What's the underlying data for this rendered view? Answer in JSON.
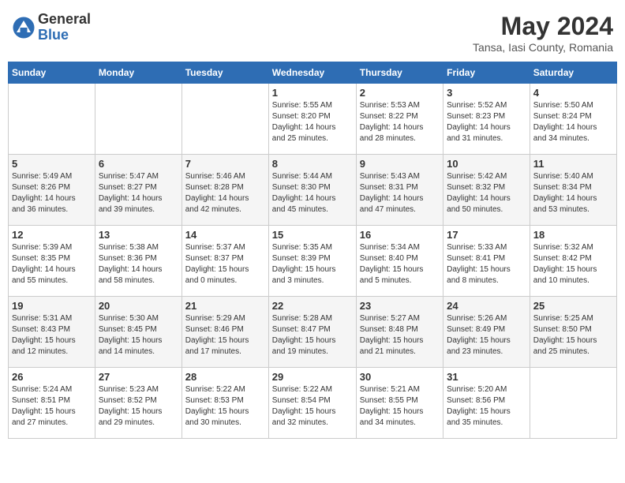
{
  "header": {
    "logo_general": "General",
    "logo_blue": "Blue",
    "month_year": "May 2024",
    "location": "Tansa, Iasi County, Romania"
  },
  "days_of_week": [
    "Sunday",
    "Monday",
    "Tuesday",
    "Wednesday",
    "Thursday",
    "Friday",
    "Saturday"
  ],
  "weeks": [
    [
      {
        "day": "",
        "info": ""
      },
      {
        "day": "",
        "info": ""
      },
      {
        "day": "",
        "info": ""
      },
      {
        "day": "1",
        "info": "Sunrise: 5:55 AM\nSunset: 8:20 PM\nDaylight: 14 hours\nand 25 minutes."
      },
      {
        "day": "2",
        "info": "Sunrise: 5:53 AM\nSunset: 8:22 PM\nDaylight: 14 hours\nand 28 minutes."
      },
      {
        "day": "3",
        "info": "Sunrise: 5:52 AM\nSunset: 8:23 PM\nDaylight: 14 hours\nand 31 minutes."
      },
      {
        "day": "4",
        "info": "Sunrise: 5:50 AM\nSunset: 8:24 PM\nDaylight: 14 hours\nand 34 minutes."
      }
    ],
    [
      {
        "day": "5",
        "info": "Sunrise: 5:49 AM\nSunset: 8:26 PM\nDaylight: 14 hours\nand 36 minutes."
      },
      {
        "day": "6",
        "info": "Sunrise: 5:47 AM\nSunset: 8:27 PM\nDaylight: 14 hours\nand 39 minutes."
      },
      {
        "day": "7",
        "info": "Sunrise: 5:46 AM\nSunset: 8:28 PM\nDaylight: 14 hours\nand 42 minutes."
      },
      {
        "day": "8",
        "info": "Sunrise: 5:44 AM\nSunset: 8:30 PM\nDaylight: 14 hours\nand 45 minutes."
      },
      {
        "day": "9",
        "info": "Sunrise: 5:43 AM\nSunset: 8:31 PM\nDaylight: 14 hours\nand 47 minutes."
      },
      {
        "day": "10",
        "info": "Sunrise: 5:42 AM\nSunset: 8:32 PM\nDaylight: 14 hours\nand 50 minutes."
      },
      {
        "day": "11",
        "info": "Sunrise: 5:40 AM\nSunset: 8:34 PM\nDaylight: 14 hours\nand 53 minutes."
      }
    ],
    [
      {
        "day": "12",
        "info": "Sunrise: 5:39 AM\nSunset: 8:35 PM\nDaylight: 14 hours\nand 55 minutes."
      },
      {
        "day": "13",
        "info": "Sunrise: 5:38 AM\nSunset: 8:36 PM\nDaylight: 14 hours\nand 58 minutes."
      },
      {
        "day": "14",
        "info": "Sunrise: 5:37 AM\nSunset: 8:37 PM\nDaylight: 15 hours\nand 0 minutes."
      },
      {
        "day": "15",
        "info": "Sunrise: 5:35 AM\nSunset: 8:39 PM\nDaylight: 15 hours\nand 3 minutes."
      },
      {
        "day": "16",
        "info": "Sunrise: 5:34 AM\nSunset: 8:40 PM\nDaylight: 15 hours\nand 5 minutes."
      },
      {
        "day": "17",
        "info": "Sunrise: 5:33 AM\nSunset: 8:41 PM\nDaylight: 15 hours\nand 8 minutes."
      },
      {
        "day": "18",
        "info": "Sunrise: 5:32 AM\nSunset: 8:42 PM\nDaylight: 15 hours\nand 10 minutes."
      }
    ],
    [
      {
        "day": "19",
        "info": "Sunrise: 5:31 AM\nSunset: 8:43 PM\nDaylight: 15 hours\nand 12 minutes."
      },
      {
        "day": "20",
        "info": "Sunrise: 5:30 AM\nSunset: 8:45 PM\nDaylight: 15 hours\nand 14 minutes."
      },
      {
        "day": "21",
        "info": "Sunrise: 5:29 AM\nSunset: 8:46 PM\nDaylight: 15 hours\nand 17 minutes."
      },
      {
        "day": "22",
        "info": "Sunrise: 5:28 AM\nSunset: 8:47 PM\nDaylight: 15 hours\nand 19 minutes."
      },
      {
        "day": "23",
        "info": "Sunrise: 5:27 AM\nSunset: 8:48 PM\nDaylight: 15 hours\nand 21 minutes."
      },
      {
        "day": "24",
        "info": "Sunrise: 5:26 AM\nSunset: 8:49 PM\nDaylight: 15 hours\nand 23 minutes."
      },
      {
        "day": "25",
        "info": "Sunrise: 5:25 AM\nSunset: 8:50 PM\nDaylight: 15 hours\nand 25 minutes."
      }
    ],
    [
      {
        "day": "26",
        "info": "Sunrise: 5:24 AM\nSunset: 8:51 PM\nDaylight: 15 hours\nand 27 minutes."
      },
      {
        "day": "27",
        "info": "Sunrise: 5:23 AM\nSunset: 8:52 PM\nDaylight: 15 hours\nand 29 minutes."
      },
      {
        "day": "28",
        "info": "Sunrise: 5:22 AM\nSunset: 8:53 PM\nDaylight: 15 hours\nand 30 minutes."
      },
      {
        "day": "29",
        "info": "Sunrise: 5:22 AM\nSunset: 8:54 PM\nDaylight: 15 hours\nand 32 minutes."
      },
      {
        "day": "30",
        "info": "Sunrise: 5:21 AM\nSunset: 8:55 PM\nDaylight: 15 hours\nand 34 minutes."
      },
      {
        "day": "31",
        "info": "Sunrise: 5:20 AM\nSunset: 8:56 PM\nDaylight: 15 hours\nand 35 minutes."
      },
      {
        "day": "",
        "info": ""
      }
    ]
  ]
}
